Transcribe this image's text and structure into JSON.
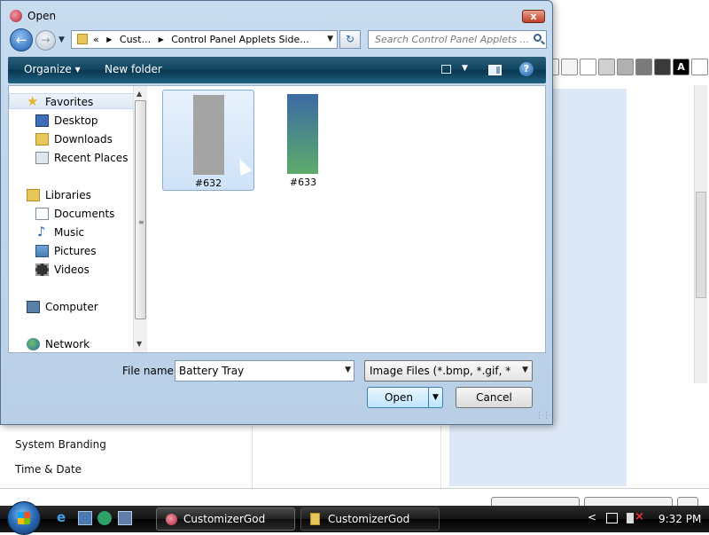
{
  "dialog": {
    "title": "Open",
    "close_label": "x"
  },
  "address": {
    "prefix": "«",
    "crumbs": [
      "Cust...",
      "Control Panel Applets Side..."
    ]
  },
  "search": {
    "placeholder": "Search Control Panel Applets ..."
  },
  "toolbar": {
    "organize_label": "Organize ▾",
    "new_folder_label": "New folder",
    "help_label": "?"
  },
  "nav": {
    "favorites": "Favorites",
    "desktop": "Desktop",
    "downloads": "Downloads",
    "recent": "Recent Places",
    "libraries": "Libraries",
    "documents": "Documents",
    "music": "Music",
    "pictures": "Pictures",
    "videos": "Videos",
    "computer": "Computer",
    "network": "Network"
  },
  "files": [
    {
      "name": "#632",
      "color_top": "#a4a4a4",
      "color_bottom": "#a4a4a4",
      "selected": true
    },
    {
      "name": "#633",
      "color_top": "#3b6aa5",
      "color_bottom": "#5dab6a",
      "selected": false
    }
  ],
  "footer": {
    "filename_label": "File name:",
    "filename_value": "Battery Tray",
    "filetype_value": "Image Files (*.bmp, *.gif, *.jpg,",
    "open_label": "Open",
    "cancel_label": "Cancel"
  },
  "background": {
    "items": [
      "System Branding",
      "Time & Date"
    ],
    "swatch_letter": "A",
    "swatches": [
      "#ffffff",
      "#f4f4f4",
      "#ffffff",
      "#d0d0d0",
      "#b0b0b0",
      "#7a7a7a",
      "#3a3a3a",
      "#000000",
      "#ffffff"
    ]
  },
  "taskbar": {
    "tasks": [
      "CustomizerGod",
      "CustomizerGod"
    ],
    "tray_chevron": "<",
    "clock": "9:32 PM"
  }
}
